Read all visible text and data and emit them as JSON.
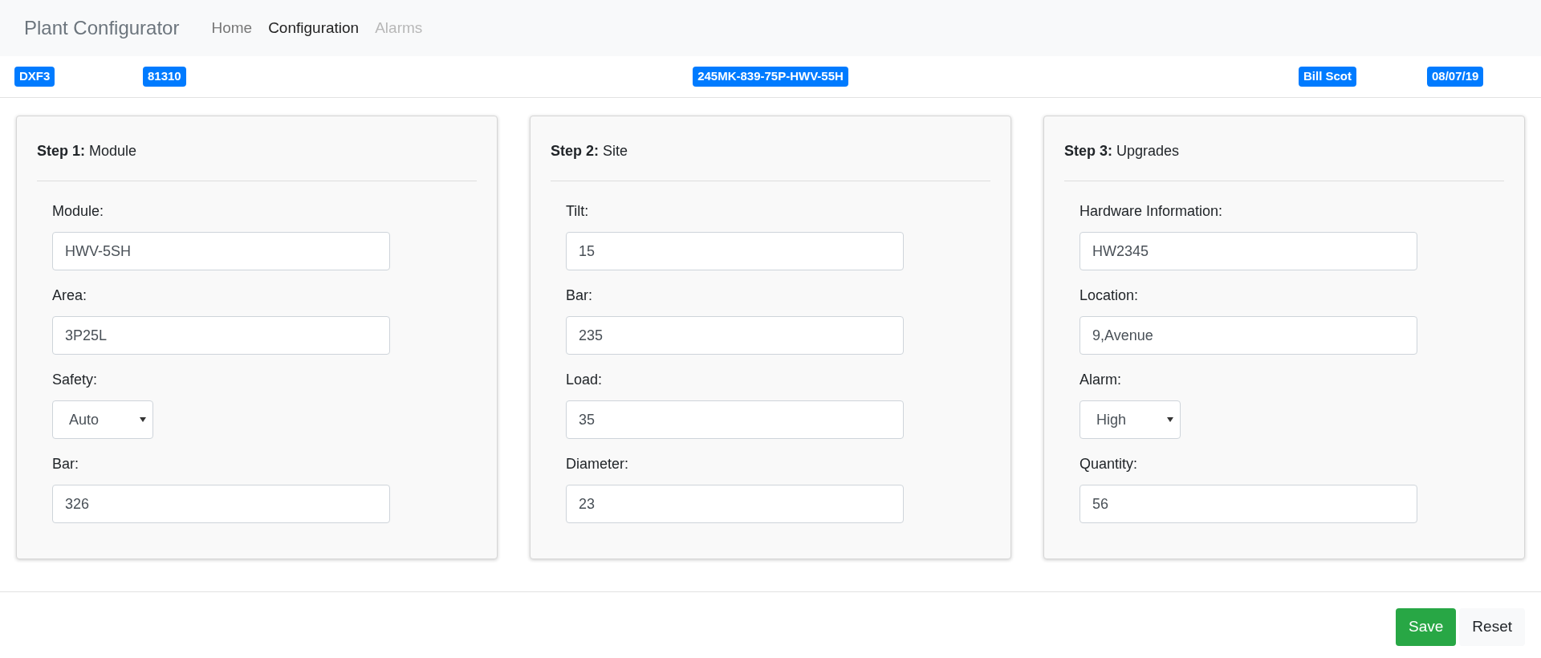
{
  "navbar": {
    "brand": "Plant Configurator",
    "items": [
      {
        "label": "Home",
        "selected": false,
        "disabled": false
      },
      {
        "label": "Configuration",
        "selected": true,
        "disabled": false
      },
      {
        "label": "Alarms",
        "selected": false,
        "disabled": true
      }
    ]
  },
  "badges": [
    "DXF3",
    "81310",
    "245MK-839-75P-HWV-55H",
    "Bill Scot",
    "08/07/19"
  ],
  "steps": [
    {
      "step": "Step 1:",
      "title": "Module",
      "fields": [
        {
          "kind": "text",
          "label": "Module:",
          "value": "HWV-5SH"
        },
        {
          "kind": "text",
          "label": "Area:",
          "value": "3P25L"
        },
        {
          "kind": "select",
          "label": "Safety:",
          "value": "Auto"
        },
        {
          "kind": "text",
          "label": "Bar:",
          "value": "326"
        }
      ]
    },
    {
      "step": "Step 2:",
      "title": "Site",
      "fields": [
        {
          "kind": "text",
          "label": "Tilt:",
          "value": "15"
        },
        {
          "kind": "text",
          "label": "Bar:",
          "value": "235"
        },
        {
          "kind": "text",
          "label": "Load:",
          "value": "35"
        },
        {
          "kind": "text",
          "label": "Diameter:",
          "value": "23"
        }
      ]
    },
    {
      "step": "Step 3:",
      "title": "Upgrades",
      "fields": [
        {
          "kind": "text",
          "label": "Hardware Information:",
          "value": "HW2345"
        },
        {
          "kind": "text",
          "label": "Location:",
          "value": "9,Avenue"
        },
        {
          "kind": "select",
          "label": "Alarm:",
          "value": "High"
        },
        {
          "kind": "text",
          "label": "Quantity:",
          "value": "56"
        }
      ]
    }
  ],
  "buttons": [
    {
      "kind": "primary",
      "label": "Save"
    },
    {
      "kind": "secondary",
      "label": "Reset"
    }
  ]
}
